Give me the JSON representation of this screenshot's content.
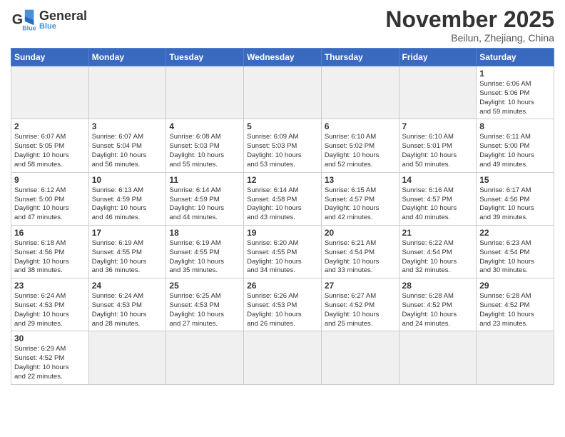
{
  "header": {
    "logo_general": "General",
    "logo_blue": "Blue",
    "month": "November 2025",
    "location": "Beilun, Zhejiang, China"
  },
  "weekdays": [
    "Sunday",
    "Monday",
    "Tuesday",
    "Wednesday",
    "Thursday",
    "Friday",
    "Saturday"
  ],
  "weeks": [
    [
      {
        "day": "",
        "info": "",
        "empty": true
      },
      {
        "day": "",
        "info": "",
        "empty": true
      },
      {
        "day": "",
        "info": "",
        "empty": true
      },
      {
        "day": "",
        "info": "",
        "empty": true
      },
      {
        "day": "",
        "info": "",
        "empty": true
      },
      {
        "day": "",
        "info": "",
        "empty": true
      },
      {
        "day": "1",
        "info": "Sunrise: 6:06 AM\nSunset: 5:06 PM\nDaylight: 10 hours\nand 59 minutes."
      }
    ],
    [
      {
        "day": "2",
        "info": "Sunrise: 6:07 AM\nSunset: 5:05 PM\nDaylight: 10 hours\nand 58 minutes."
      },
      {
        "day": "3",
        "info": "Sunrise: 6:07 AM\nSunset: 5:04 PM\nDaylight: 10 hours\nand 56 minutes."
      },
      {
        "day": "4",
        "info": "Sunrise: 6:08 AM\nSunset: 5:03 PM\nDaylight: 10 hours\nand 55 minutes."
      },
      {
        "day": "5",
        "info": "Sunrise: 6:09 AM\nSunset: 5:03 PM\nDaylight: 10 hours\nand 53 minutes."
      },
      {
        "day": "6",
        "info": "Sunrise: 6:10 AM\nSunset: 5:02 PM\nDaylight: 10 hours\nand 52 minutes."
      },
      {
        "day": "7",
        "info": "Sunrise: 6:10 AM\nSunset: 5:01 PM\nDaylight: 10 hours\nand 50 minutes."
      },
      {
        "day": "8",
        "info": "Sunrise: 6:11 AM\nSunset: 5:00 PM\nDaylight: 10 hours\nand 49 minutes."
      }
    ],
    [
      {
        "day": "9",
        "info": "Sunrise: 6:12 AM\nSunset: 5:00 PM\nDaylight: 10 hours\nand 47 minutes."
      },
      {
        "day": "10",
        "info": "Sunrise: 6:13 AM\nSunset: 4:59 PM\nDaylight: 10 hours\nand 46 minutes."
      },
      {
        "day": "11",
        "info": "Sunrise: 6:14 AM\nSunset: 4:59 PM\nDaylight: 10 hours\nand 44 minutes."
      },
      {
        "day": "12",
        "info": "Sunrise: 6:14 AM\nSunset: 4:58 PM\nDaylight: 10 hours\nand 43 minutes."
      },
      {
        "day": "13",
        "info": "Sunrise: 6:15 AM\nSunset: 4:57 PM\nDaylight: 10 hours\nand 42 minutes."
      },
      {
        "day": "14",
        "info": "Sunrise: 6:16 AM\nSunset: 4:57 PM\nDaylight: 10 hours\nand 40 minutes."
      },
      {
        "day": "15",
        "info": "Sunrise: 6:17 AM\nSunset: 4:56 PM\nDaylight: 10 hours\nand 39 minutes."
      }
    ],
    [
      {
        "day": "16",
        "info": "Sunrise: 6:18 AM\nSunset: 4:56 PM\nDaylight: 10 hours\nand 38 minutes."
      },
      {
        "day": "17",
        "info": "Sunrise: 6:19 AM\nSunset: 4:55 PM\nDaylight: 10 hours\nand 36 minutes."
      },
      {
        "day": "18",
        "info": "Sunrise: 6:19 AM\nSunset: 4:55 PM\nDaylight: 10 hours\nand 35 minutes."
      },
      {
        "day": "19",
        "info": "Sunrise: 6:20 AM\nSunset: 4:55 PM\nDaylight: 10 hours\nand 34 minutes."
      },
      {
        "day": "20",
        "info": "Sunrise: 6:21 AM\nSunset: 4:54 PM\nDaylight: 10 hours\nand 33 minutes."
      },
      {
        "day": "21",
        "info": "Sunrise: 6:22 AM\nSunset: 4:54 PM\nDaylight: 10 hours\nand 32 minutes."
      },
      {
        "day": "22",
        "info": "Sunrise: 6:23 AM\nSunset: 4:54 PM\nDaylight: 10 hours\nand 30 minutes."
      }
    ],
    [
      {
        "day": "23",
        "info": "Sunrise: 6:24 AM\nSunset: 4:53 PM\nDaylight: 10 hours\nand 29 minutes."
      },
      {
        "day": "24",
        "info": "Sunrise: 6:24 AM\nSunset: 4:53 PM\nDaylight: 10 hours\nand 28 minutes."
      },
      {
        "day": "25",
        "info": "Sunrise: 6:25 AM\nSunset: 4:53 PM\nDaylight: 10 hours\nand 27 minutes."
      },
      {
        "day": "26",
        "info": "Sunrise: 6:26 AM\nSunset: 4:53 PM\nDaylight: 10 hours\nand 26 minutes."
      },
      {
        "day": "27",
        "info": "Sunrise: 6:27 AM\nSunset: 4:52 PM\nDaylight: 10 hours\nand 25 minutes."
      },
      {
        "day": "28",
        "info": "Sunrise: 6:28 AM\nSunset: 4:52 PM\nDaylight: 10 hours\nand 24 minutes."
      },
      {
        "day": "29",
        "info": "Sunrise: 6:28 AM\nSunset: 4:52 PM\nDaylight: 10 hours\nand 23 minutes."
      }
    ],
    [
      {
        "day": "30",
        "info": "Sunrise: 6:29 AM\nSunset: 4:52 PM\nDaylight: 10 hours\nand 22 minutes."
      },
      {
        "day": "",
        "info": "",
        "empty": true
      },
      {
        "day": "",
        "info": "",
        "empty": true
      },
      {
        "day": "",
        "info": "",
        "empty": true
      },
      {
        "day": "",
        "info": "",
        "empty": true
      },
      {
        "day": "",
        "info": "",
        "empty": true
      },
      {
        "day": "",
        "info": "",
        "empty": true
      }
    ]
  ]
}
